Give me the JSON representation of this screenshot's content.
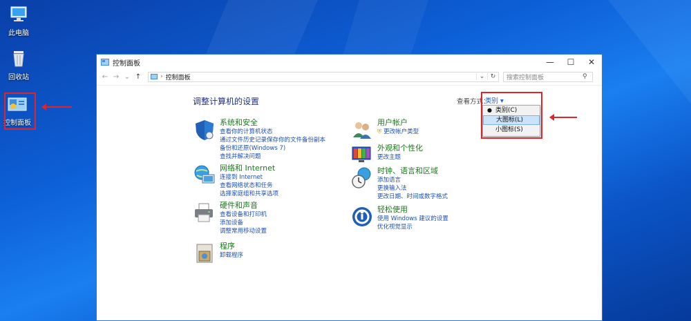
{
  "desktop": {
    "icons": [
      {
        "label": "此电脑",
        "icon": "computer-icon"
      },
      {
        "label": "回收站",
        "icon": "recycle-bin-icon"
      },
      {
        "label": "控制面板",
        "icon": "control-panel-icon"
      }
    ]
  },
  "window": {
    "title": "控制面板",
    "controls": {
      "minimize": "—",
      "maximize": "☐",
      "close": "✕"
    },
    "nav": {
      "back": "←",
      "forward": "→",
      "recent": "⌄",
      "up": "↑"
    },
    "address": {
      "segments": [
        "控制面板"
      ],
      "dropdown": "⌄",
      "refresh": "↻"
    },
    "search": {
      "placeholder": "搜索控制面板",
      "icon": "search-icon"
    }
  },
  "content": {
    "heading": "调整计算机的设置",
    "view_by_label": "查看方式：",
    "view_by_value": "类别 ▾",
    "view_menu": {
      "options": [
        {
          "label": "类别(C)",
          "selected": true
        },
        {
          "label": "大图标(L)",
          "highlighted": true
        },
        {
          "label": "小图标(S)"
        }
      ]
    },
    "categories_left": [
      {
        "title": "系统和安全",
        "icon": "shield-icon",
        "links": [
          "查看你的计算机状态",
          "通过文件历史记录保存你的文件备份副本",
          "备份和还原(Windows 7)",
          "查找并解决问题"
        ]
      },
      {
        "title": "网络和 Internet",
        "icon": "network-globe-icon",
        "links": [
          "连接到 Internet",
          "查看网络状态和任务",
          "选择家庭组和共享选项"
        ]
      },
      {
        "title": "硬件和声音",
        "icon": "printer-icon",
        "links": [
          "查看设备和打印机",
          "添加设备",
          "调整常用移动设置"
        ]
      },
      {
        "title": "程序",
        "icon": "programs-icon",
        "links": [
          "卸载程序"
        ]
      }
    ],
    "categories_right": [
      {
        "title": "用户帐户",
        "icon": "users-icon",
        "links": [
          "更改帐户类型"
        ]
      },
      {
        "title": "外观和个性化",
        "icon": "appearance-icon",
        "links": [
          "更改主题"
        ]
      },
      {
        "title": "时钟、语言和区域",
        "icon": "clock-globe-icon",
        "links": [
          "添加语言",
          "更换输入法",
          "更改日期、时间或数字格式"
        ]
      },
      {
        "title": "轻松使用",
        "icon": "ease-of-access-icon",
        "links": [
          "使用 Windows 建议的设置",
          "优化视觉显示"
        ]
      }
    ]
  },
  "colors": {
    "desktop": "#0d5fd6",
    "link": "#1c4fb5",
    "category_title": "#1a7a1a",
    "annotation": "#e0242a"
  }
}
